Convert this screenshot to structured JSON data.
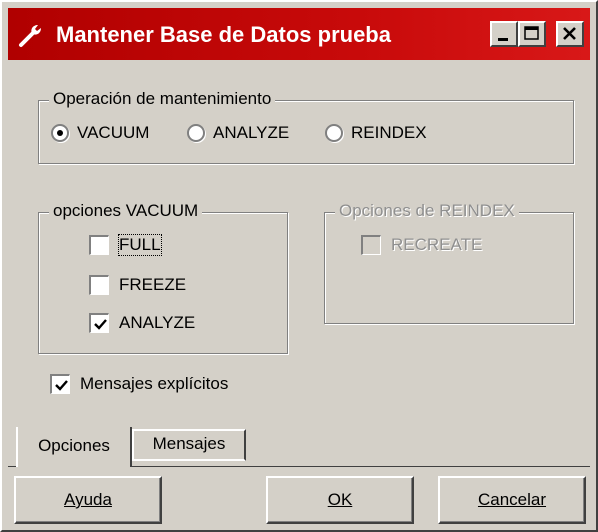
{
  "window": {
    "title": "Mantener Base de Datos prueba",
    "title_icon": "wrench-icon",
    "title_bar_color": "#c00000",
    "controls": [
      "minimize-icon",
      "maximize-icon",
      "close-icon"
    ]
  },
  "operation_group": {
    "legend": "Operación de mantenimiento",
    "options": [
      {
        "label": "VACUUM",
        "selected": true
      },
      {
        "label": "ANALYZE",
        "selected": false
      },
      {
        "label": "REINDEX",
        "selected": false
      }
    ]
  },
  "vacuum_group": {
    "legend": "opciones VACUUM",
    "options": [
      {
        "label": "FULL",
        "checked": false
      },
      {
        "label": "FREEZE",
        "checked": false
      },
      {
        "label": "ANALYZE",
        "checked": true
      }
    ]
  },
  "reindex_group": {
    "legend": "Opciones de REINDEX",
    "enabled": false,
    "options": [
      {
        "label": "RECREATE",
        "checked": false
      }
    ]
  },
  "verbose": {
    "label": "Mensajes explícitos",
    "checked": true
  },
  "tabs": [
    {
      "label": "Opciones",
      "active": true
    },
    {
      "label": "Mensajes",
      "active": false
    }
  ],
  "buttons": {
    "help": "Ayuda",
    "ok": "OK",
    "cancel": "Cancelar"
  }
}
